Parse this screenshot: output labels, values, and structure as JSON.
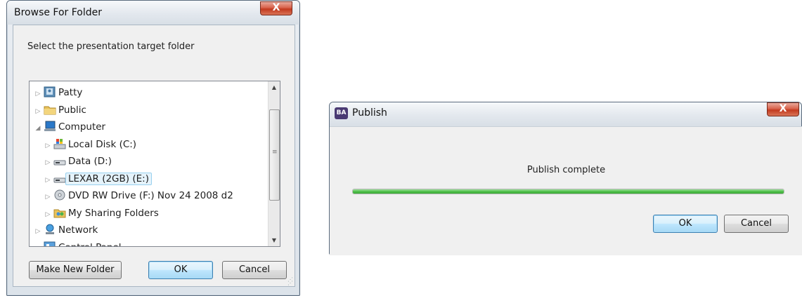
{
  "browse_dialog": {
    "title": "Browse For Folder",
    "instruction": "Select the presentation target folder",
    "tree": [
      {
        "label": "Patty",
        "icon": "user-folder-icon",
        "level": 0,
        "expanded": false,
        "selected": false
      },
      {
        "label": "Public",
        "icon": "folder-icon",
        "level": 0,
        "expanded": false,
        "selected": false
      },
      {
        "label": "Computer",
        "icon": "computer-icon",
        "level": 0,
        "expanded": true,
        "selected": false
      },
      {
        "label": "Local Disk (C:)",
        "icon": "windows-drive-icon",
        "level": 1,
        "expanded": false,
        "selected": false
      },
      {
        "label": "Data (D:)",
        "icon": "drive-icon",
        "level": 1,
        "expanded": false,
        "selected": false
      },
      {
        "label": "LEXAR (2GB) (E:)",
        "icon": "drive-icon",
        "level": 1,
        "expanded": false,
        "selected": true
      },
      {
        "label": "DVD RW Drive (F:) Nov 24 2008 d2",
        "icon": "dvd-icon",
        "level": 1,
        "expanded": false,
        "selected": false
      },
      {
        "label": "My Sharing Folders",
        "icon": "sharing-folder-icon",
        "level": 1,
        "expanded": false,
        "selected": false
      },
      {
        "label": "Network",
        "icon": "network-icon",
        "level": 0,
        "expanded": false,
        "selected": false
      },
      {
        "label": "Control Panel",
        "icon": "control-panel-icon",
        "level": 0,
        "expanded": false,
        "selected": false
      }
    ],
    "buttons": {
      "make_new_folder": "Make New Folder",
      "ok": "OK",
      "cancel": "Cancel"
    },
    "close_glyph": "X"
  },
  "publish_dialog": {
    "title": "Publish",
    "app_icon_text": "BA",
    "status": "Publish complete",
    "progress": 1.0,
    "progress_color": "#4fbe4a",
    "buttons": {
      "ok": "OK",
      "cancel": "Cancel"
    },
    "close_glyph": "X"
  }
}
